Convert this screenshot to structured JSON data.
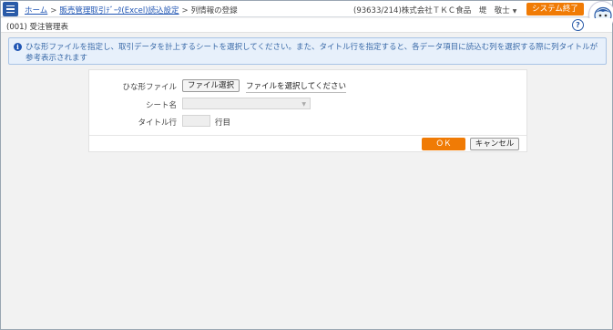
{
  "header": {
    "breadcrumb": [
      "ホーム",
      "販売管理取引ﾃﾞｰﾀ(Excel)読込設定",
      "列情報の登録"
    ],
    "user_info": "(93633/214)株式会社ＴＫＣ食品　堤　敬士",
    "exit_label": "システム終了"
  },
  "subheader": {
    "title": "(001) 受注管理表"
  },
  "notice": {
    "text": "ひな形ファイルを指定し、取引データを計上するシートを選択してください。また、タイトル行を指定すると、各データ項目に読込む列を選択する際に列タイトルが参考表示されます"
  },
  "form": {
    "template_label": "ひな形ファイル",
    "file_button": "ファイル選択",
    "file_status": "ファイルを選択してください",
    "sheet_label": "シート名",
    "sheet_value": "",
    "title_row_label": "タイトル行",
    "title_row_value": "",
    "title_row_suffix": "行目"
  },
  "footer": {
    "ok_label": "ＯＫ",
    "cancel_label": "キャンセル"
  },
  "colors": {
    "brand_blue": "#2a5ba8",
    "accent_orange": "#f07b05",
    "notice_bg": "#e7f0fb"
  }
}
